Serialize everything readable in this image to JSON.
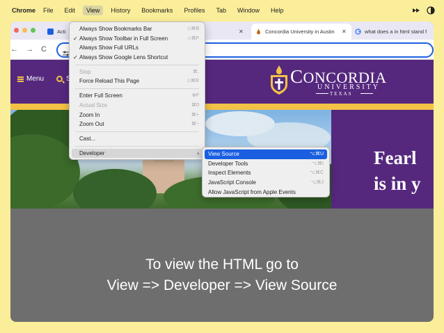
{
  "menubar": {
    "app": "Chrome",
    "items": [
      "File",
      "Edit",
      "View",
      "History",
      "Bookmarks",
      "Profiles",
      "Tab",
      "Window",
      "Help"
    ]
  },
  "tabs": [
    {
      "title": "Acti",
      "favicon_color": "#1a5fe0"
    },
    {
      "title": "Concordia University in Austin",
      "favicon_color": "#c66a1c",
      "close": "✕"
    },
    {
      "title": "what does a in html stand f",
      "favicon_color": "#4285f4"
    }
  ],
  "toolbar": {
    "back": "←",
    "forward": "→",
    "reload": "C"
  },
  "site": {
    "menu_label": "Menu",
    "search_letter": "S",
    "logo_name_c": "C",
    "logo_name_rest": "ONCORDIA",
    "logo_university": "UNIVERSITY",
    "logo_texas": "TEXAS",
    "hero_line1": "Fearl",
    "hero_line2": "is in y",
    "colors": {
      "purple": "#55287e",
      "gold": "#f3c246"
    }
  },
  "view_menu": {
    "items": [
      {
        "label": "Always Show Bookmarks Bar",
        "shortcut": "◇⌘B",
        "checked": false
      },
      {
        "label": "Always Show Toolbar in Full Screen",
        "shortcut": "◇⌘F",
        "checked": true
      },
      {
        "label": "Always Show Full URLs",
        "shortcut": "",
        "checked": false
      },
      {
        "label": "Always Show Google Lens Shortcut",
        "shortcut": "",
        "checked": true
      },
      {
        "label": "Stop",
        "shortcut": "⌘.",
        "disabled": true
      },
      {
        "label": "Force Reload This Page",
        "shortcut": "◇⌘R"
      },
      {
        "label": "Enter Full Screen",
        "shortcut": "⊕F"
      },
      {
        "label": "Actual Size",
        "shortcut": "⌘0",
        "disabled": true
      },
      {
        "label": "Zoom In",
        "shortcut": "⌘+"
      },
      {
        "label": "Zoom Out",
        "shortcut": "⌘−"
      },
      {
        "label": "Cast...",
        "shortcut": ""
      },
      {
        "label": "Developer",
        "shortcut": "›"
      }
    ]
  },
  "developer_menu": {
    "items": [
      {
        "label": "View Source",
        "shortcut": "⌥⌘U",
        "selected": true
      },
      {
        "label": "Developer Tools",
        "shortcut": "⌥⌘I"
      },
      {
        "label": "Inspect Elements",
        "shortcut": "⌥⌘C"
      },
      {
        "label": "JavaScript Console",
        "shortcut": "⌥⌘J"
      },
      {
        "label": "Allow JavaScript from Apple Events",
        "shortcut": ""
      }
    ]
  },
  "caption": {
    "line1": "To view the HTML go to",
    "line2": "View => Developer => View Source"
  }
}
